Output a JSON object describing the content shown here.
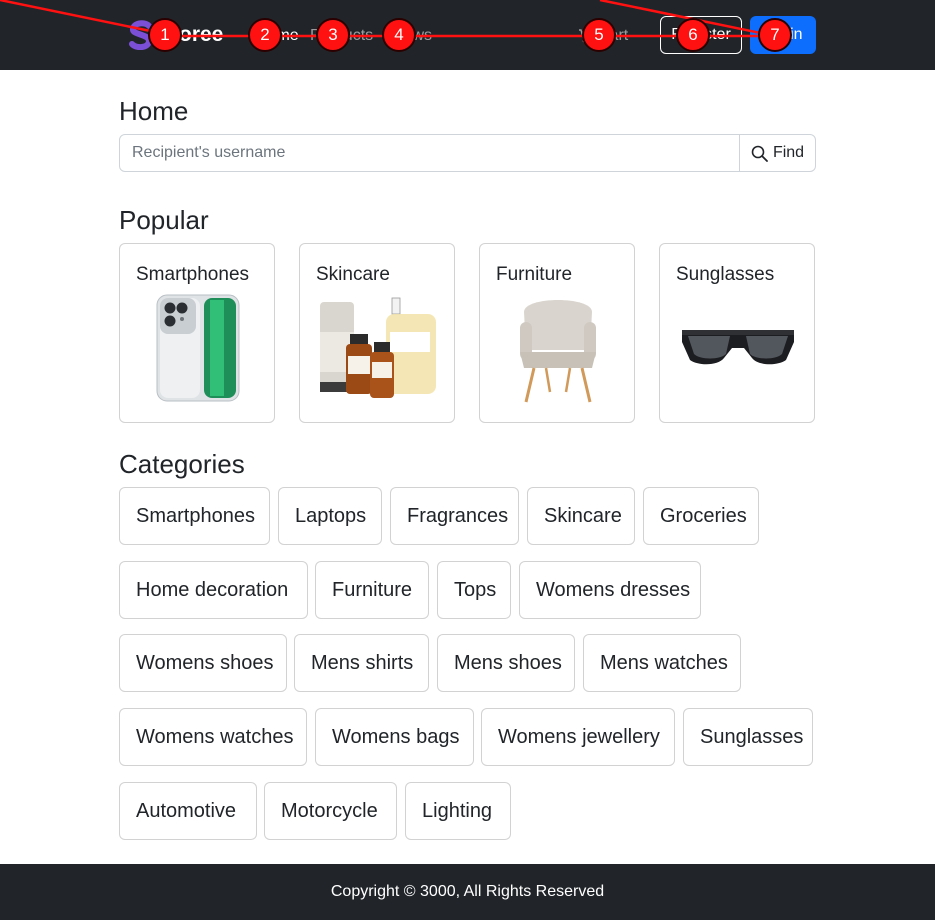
{
  "navbar": {
    "brand": "Storee",
    "links": {
      "home": "Home",
      "products": "Products",
      "news": "News",
      "cart": "Cart"
    },
    "register_label": "Register",
    "login_label": "Login"
  },
  "home": {
    "title": "Home",
    "search": {
      "placeholder": "Recipient's username",
      "value": "",
      "button_label": "Find"
    }
  },
  "popular": {
    "title": "Popular",
    "items": [
      {
        "label": "Smartphones",
        "image": "smartphone-image"
      },
      {
        "label": "Skincare",
        "image": "skincare-image"
      },
      {
        "label": "Furniture",
        "image": "chair-image"
      },
      {
        "label": "Sunglasses",
        "image": "sunglasses-image"
      }
    ]
  },
  "categories": {
    "title": "Categories",
    "items": [
      "Smartphones",
      "Laptops",
      "Fragrances",
      "Skincare",
      "Groceries",
      "Home decoration",
      "Furniture",
      "Tops",
      "Womens dresses",
      "Womens shoes",
      "Mens shirts",
      "Mens shoes",
      "Mens watches",
      "Womens watches",
      "Womens bags",
      "Womens jewellery",
      "Sunglasses",
      "Automotive",
      "Motorcycle",
      "Lighting"
    ]
  },
  "footer": {
    "copyright": "Copyright © 3000, All Rights Reserved"
  },
  "annotations": {
    "markers": [
      "1",
      "2",
      "3",
      "4",
      "5",
      "6",
      "7"
    ]
  },
  "colors": {
    "navbar_bg": "#212529",
    "primary": "#0d6efd",
    "brand_logo": "#7b4fd6",
    "marker": "#ff1111"
  }
}
